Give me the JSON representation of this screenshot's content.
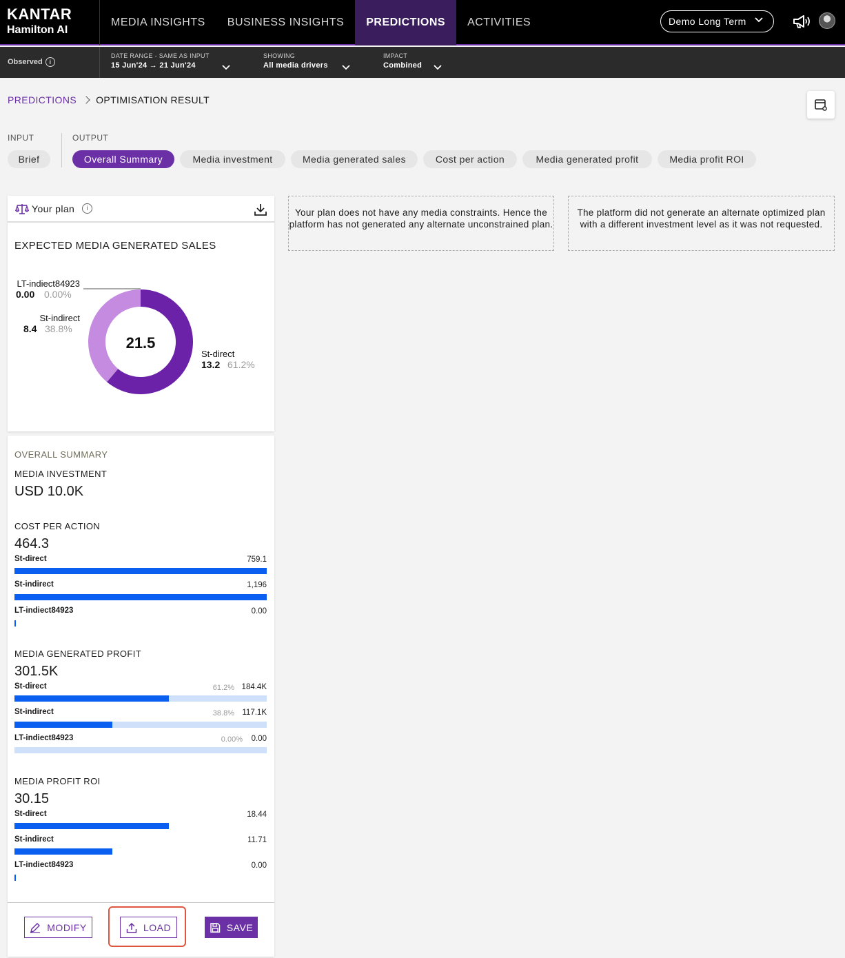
{
  "brand": {
    "line1": "KANTAR",
    "line2": "Hamilton AI"
  },
  "nav": [
    "MEDIA INSIGHTS",
    "BUSINESS INSIGHTS",
    "PREDICTIONS",
    "ACTIVITIES"
  ],
  "nav_active": "PREDICTIONS",
  "account": {
    "name": "Demo Long Term"
  },
  "filterbar": {
    "observed": "Observed",
    "date_label": "DATE RANGE - SAME AS INPUT",
    "date_value": "15 Jun'24 → 21 Jun'24",
    "showing_label": "SHOWING",
    "showing_value": "All media drivers",
    "impact_label": "IMPACT",
    "impact_value": "Combined"
  },
  "breadcrumb": {
    "parent": "PREDICTIONS",
    "current": "OPTIMISATION RESULT"
  },
  "sections": {
    "input": "INPUT",
    "output": "OUTPUT"
  },
  "input_tabs": [
    "Brief"
  ],
  "output_tabs": [
    "Overall Summary",
    "Media investment",
    "Media generated sales",
    "Cost per action",
    "Media generated profit",
    "Media profit ROI"
  ],
  "output_active": "Overall Summary",
  "plan": {
    "title": "Your plan",
    "chart_title": "EXPECTED MEDIA GENERATED SALES",
    "total": "21.5",
    "labels": [
      {
        "name": "LT-indiect84923",
        "value": "0.00",
        "pct": "0.00%"
      },
      {
        "name": "St-indirect",
        "value": "8.4",
        "pct": "38.8%"
      },
      {
        "name": "St-direct",
        "value": "13.2",
        "pct": "61.2%"
      }
    ]
  },
  "chart_data": {
    "type": "pie",
    "title": "EXPECTED MEDIA GENERATED SALES",
    "total": 21.5,
    "categories": [
      "St-direct",
      "St-indirect",
      "LT-indiect84923"
    ],
    "values": [
      13.2,
      8.4,
      0.0
    ],
    "percentages": [
      61.2,
      38.8,
      0.0
    ],
    "colors": [
      "#6b21a8",
      "#c58be0",
      "#9a9a9a"
    ]
  },
  "notes": [
    "Your plan does not have any media constraints. Hence the platform has not generated any alternate unconstrained plan.",
    "The platform did not generate an alternate optimized plan with a different investment level as it was not requested."
  ],
  "summary": {
    "heading": "OVERALL SUMMARY",
    "investment_label": "MEDIA INVESTMENT",
    "investment_value": "USD 10.0K",
    "cpa": {
      "label": "COST PER ACTION",
      "total": "464.3",
      "rows": [
        {
          "name": "St-direct",
          "value": "759.1",
          "fraction": 1.0
        },
        {
          "name": "St-indirect",
          "value": "1,196",
          "fraction": 1.0
        },
        {
          "name": "LT-indiect84923",
          "value": "0.00",
          "fraction": 0.0
        }
      ]
    },
    "profit": {
      "label": "MEDIA GENERATED PROFIT",
      "total": "301.5K",
      "rows": [
        {
          "name": "St-direct",
          "pct": "61.2%",
          "value": "184.4K",
          "fraction": 0.612
        },
        {
          "name": "St-indirect",
          "pct": "38.8%",
          "value": "117.1K",
          "fraction": 0.388
        },
        {
          "name": "LT-indiect84923",
          "pct": "0.00%",
          "value": "0.00",
          "fraction": 0.0
        }
      ]
    },
    "roi": {
      "label": "MEDIA PROFIT ROI",
      "total": "30.15",
      "rows": [
        {
          "name": "St-direct",
          "value": "18.44",
          "fraction": 0.612
        },
        {
          "name": "St-indirect",
          "value": "11.71",
          "fraction": 0.388
        },
        {
          "name": "LT-indiect84923",
          "value": "0.00",
          "fraction": 0.0
        }
      ]
    }
  },
  "buttons": {
    "modify": "MODIFY",
    "load": "LOAD",
    "save": "SAVE"
  },
  "colors": {
    "accent": "#6b2fa6",
    "bar": "#0b5ff0",
    "bar_bg": "#cfe0fb",
    "highlight": "#e0553f"
  }
}
